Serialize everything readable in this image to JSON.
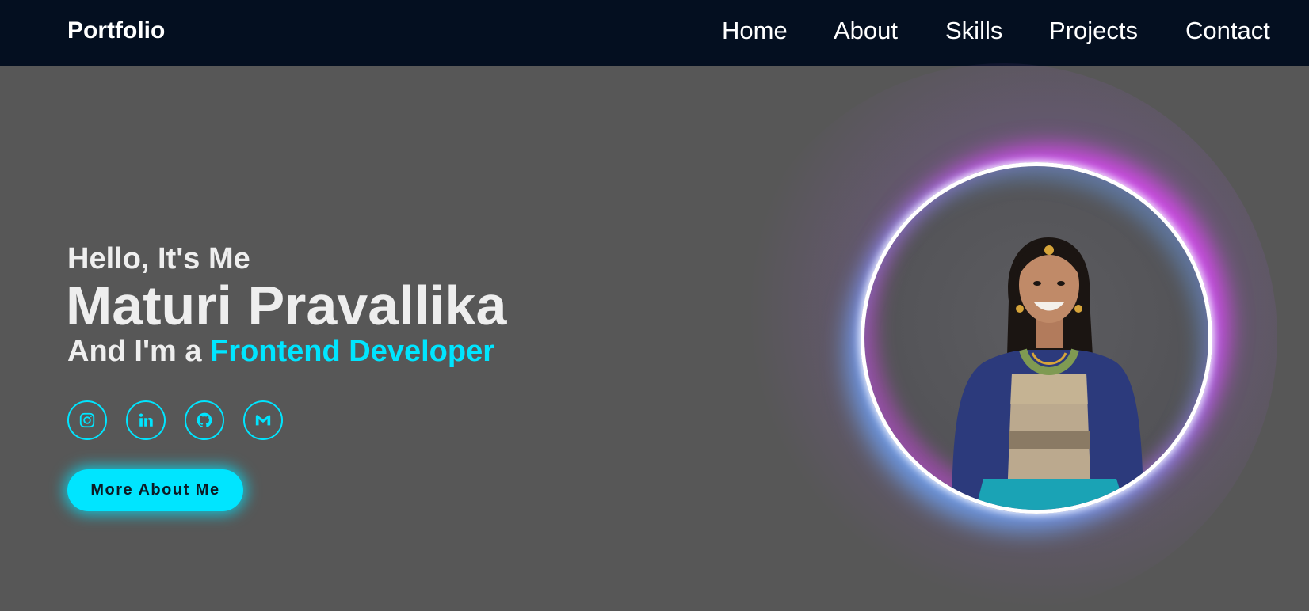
{
  "navbar": {
    "logo": "Portfolio",
    "links": [
      {
        "label": "Home"
      },
      {
        "label": "About"
      },
      {
        "label": "Skills"
      },
      {
        "label": "Projects"
      },
      {
        "label": "Contact"
      }
    ]
  },
  "hero": {
    "greeting": "Hello, It's Me",
    "name": "Maturi Pravallika",
    "role_prefix": "And I'm a",
    "role_highlight": "Frontend Developer",
    "socials": [
      {
        "icon": "instagram-icon"
      },
      {
        "icon": "linkedin-icon"
      },
      {
        "icon": "github-icon"
      },
      {
        "icon": "gmail-icon"
      }
    ],
    "button_label": "More About Me"
  },
  "colors": {
    "navbar_bg": "#040f20",
    "page_bg": "#575757",
    "accent": "#00e5ff",
    "text": "#eeeeee",
    "ring_glow_blue": "#6eaaff",
    "ring_glow_magenta": "#eb46ff"
  }
}
